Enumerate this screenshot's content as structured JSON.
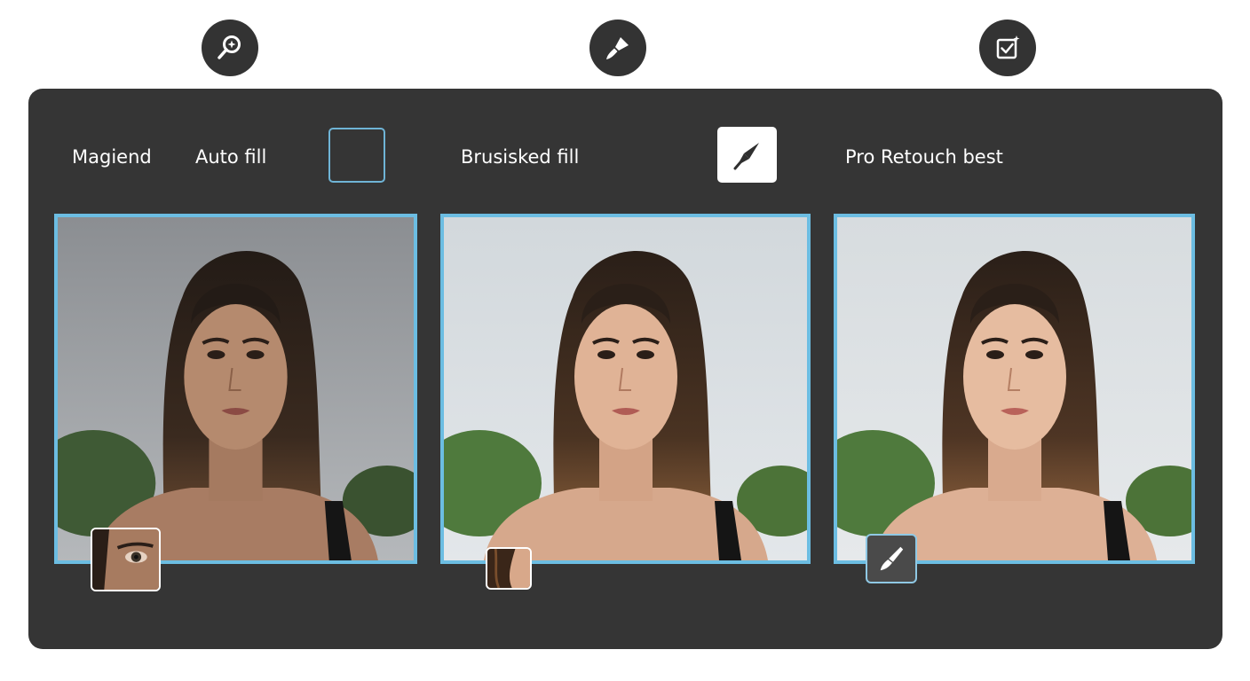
{
  "toolbar": {
    "left_label": "Magiend",
    "auto_fill_label": "Auto fill",
    "brush_fill_label": "Brusisked fill",
    "pro_label": "Pro Retouch best"
  },
  "icons": {
    "top": [
      "magnify-sparkle-icon",
      "brush-icon",
      "checkbox-sparkle-icon"
    ],
    "tool": "pen-nib-icon",
    "badge": "brush-icon"
  },
  "colors": {
    "panel": "#353535",
    "frame_border": "#6cbde2",
    "top_icon_bg": "#333333"
  },
  "images": [
    "portrait-auto-fill",
    "portrait-brush-fill",
    "portrait-pro-retouch"
  ]
}
